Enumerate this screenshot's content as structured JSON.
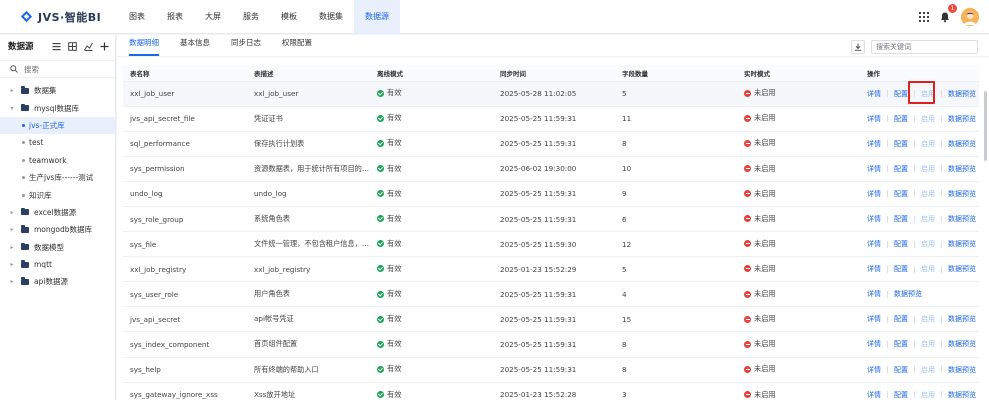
{
  "app": {
    "logo_text": "JVS·智能BI"
  },
  "nav": [
    "图表",
    "报表",
    "大屏",
    "服务",
    "模板",
    "数据集",
    "数据源"
  ],
  "nav_active": 6,
  "notifications": {
    "count": "1"
  },
  "sidebar": {
    "title": "数据源",
    "search_placeholder": "搜索",
    "tree": [
      {
        "label": "数据集",
        "level": 0,
        "type": "folder",
        "caret": "▸"
      },
      {
        "label": "mysql数据库",
        "level": 0,
        "type": "folder",
        "caret": "▾"
      },
      {
        "label": "jvs-正式库",
        "level": 1,
        "type": "leaf",
        "active": true
      },
      {
        "label": "test",
        "level": 1,
        "type": "leaf"
      },
      {
        "label": "teamwork",
        "level": 1,
        "type": "leaf"
      },
      {
        "label": "生产jvs库------测试",
        "level": 1,
        "type": "leaf"
      },
      {
        "label": "知识库",
        "level": 1,
        "type": "leaf"
      },
      {
        "label": "excel数据源",
        "level": 0,
        "type": "folder",
        "caret": "▸"
      },
      {
        "label": "mongodb数据库",
        "level": 0,
        "type": "folder",
        "caret": "▸"
      },
      {
        "label": "数据模型",
        "level": 0,
        "type": "folder",
        "caret": "▸"
      },
      {
        "label": "mqtt",
        "level": 0,
        "type": "folder",
        "caret": "▸"
      },
      {
        "label": "api数据源",
        "level": 0,
        "type": "folder",
        "caret": "▸"
      }
    ]
  },
  "tabs": [
    "数据明细",
    "基本信息",
    "同步日志",
    "权限配置"
  ],
  "tab_active": 0,
  "search": {
    "placeholder": "搜索关键词"
  },
  "table": {
    "columns": [
      "表名称",
      "表描述",
      "离线模式",
      "同步时间",
      "字段数量",
      "实时模式",
      "操作"
    ],
    "rows": [
      {
        "name": "xxl_job_user",
        "desc": "xxl_job_user",
        "offline": "有效",
        "time": "2025-05-28 11:02:05",
        "count": "5",
        "realtime": "未启用",
        "ops": [
          "详情",
          "配置",
          "启用",
          "数据预览"
        ]
      },
      {
        "name": "jvs_api_secret_file",
        "desc": "凭证证书",
        "offline": "有效",
        "time": "2025-05-25 11:59:31",
        "count": "11",
        "realtime": "未启用",
        "ops": [
          "详情",
          "配置",
          "启用",
          "数据预览"
        ]
      },
      {
        "name": "sql_performance",
        "desc": "保存执行计划表",
        "offline": "有效",
        "time": "2025-05-25 11:59:31",
        "count": "8",
        "realtime": "未启用",
        "ops": [
          "详情",
          "配置",
          "启用",
          "数据预览"
        ]
      },
      {
        "name": "sys_permission",
        "desc": "资源数据表，用于统计所有项目的…",
        "offline": "有效",
        "time": "2025-06-02 19:30:00",
        "count": "10",
        "realtime": "未启用",
        "ops": [
          "详情",
          "配置",
          "启用",
          "数据预览"
        ]
      },
      {
        "name": "undo_log",
        "desc": "undo_log",
        "offline": "有效",
        "time": "2025-05-25 11:59:31",
        "count": "9",
        "realtime": "未启用",
        "ops": [
          "详情",
          "配置",
          "启用",
          "数据预览"
        ]
      },
      {
        "name": "sys_role_group",
        "desc": "系统角色表",
        "offline": "有效",
        "time": "2025-05-25 11:59:31",
        "count": "6",
        "realtime": "未启用",
        "ops": [
          "详情",
          "配置",
          "启用",
          "数据预览"
        ]
      },
      {
        "name": "sys_file",
        "desc": "文件统一管理，不包含租户信息，…",
        "offline": "有效",
        "time": "2025-05-25 11:59:30",
        "count": "12",
        "realtime": "未启用",
        "ops": [
          "详情",
          "配置",
          "启用",
          "数据预览"
        ]
      },
      {
        "name": "xxl_job_registry",
        "desc": "xxl_job_registry",
        "offline": "有效",
        "time": "2025-01-23 15:52:29",
        "count": "5",
        "realtime": "未启用",
        "ops": [
          "详情",
          "配置",
          "启用",
          "数据预览"
        ]
      },
      {
        "name": "sys_user_role",
        "desc": "用户角色表",
        "offline": "有效",
        "time": "2025-05-25 11:59:31",
        "count": "4",
        "realtime": "未启用",
        "ops": [
          "详情",
          "数据预览"
        ]
      },
      {
        "name": "jvs_api_secret",
        "desc": "api帐号凭证",
        "offline": "有效",
        "time": "2025-05-25 11:59:31",
        "count": "15",
        "realtime": "未启用",
        "ops": [
          "详情",
          "配置",
          "启用",
          "数据预览"
        ]
      },
      {
        "name": "sys_index_component",
        "desc": "首页组件配置",
        "offline": "有效",
        "time": "2025-05-25 11:59:31",
        "count": "8",
        "realtime": "未启用",
        "ops": [
          "详情",
          "配置",
          "启用",
          "数据预览"
        ]
      },
      {
        "name": "sys_help",
        "desc": "所有终端的帮助入口",
        "offline": "有效",
        "time": "2025-05-25 11:59:31",
        "count": "8",
        "realtime": "未启用",
        "ops": [
          "详情",
          "配置",
          "启用",
          "数据预览"
        ]
      },
      {
        "name": "sys_gateway_ignore_xss",
        "desc": "Xss放开地址",
        "offline": "有效",
        "time": "2025-01-23 15:52:28",
        "count": "3",
        "realtime": "未启用",
        "ops": [
          "详情",
          "配置",
          "启用",
          "数据预览"
        ]
      }
    ]
  },
  "colors": {
    "accent": "#1a66f0",
    "ok": "#1fa35a",
    "off": "#e5413c",
    "highlight": "#e0201e"
  }
}
